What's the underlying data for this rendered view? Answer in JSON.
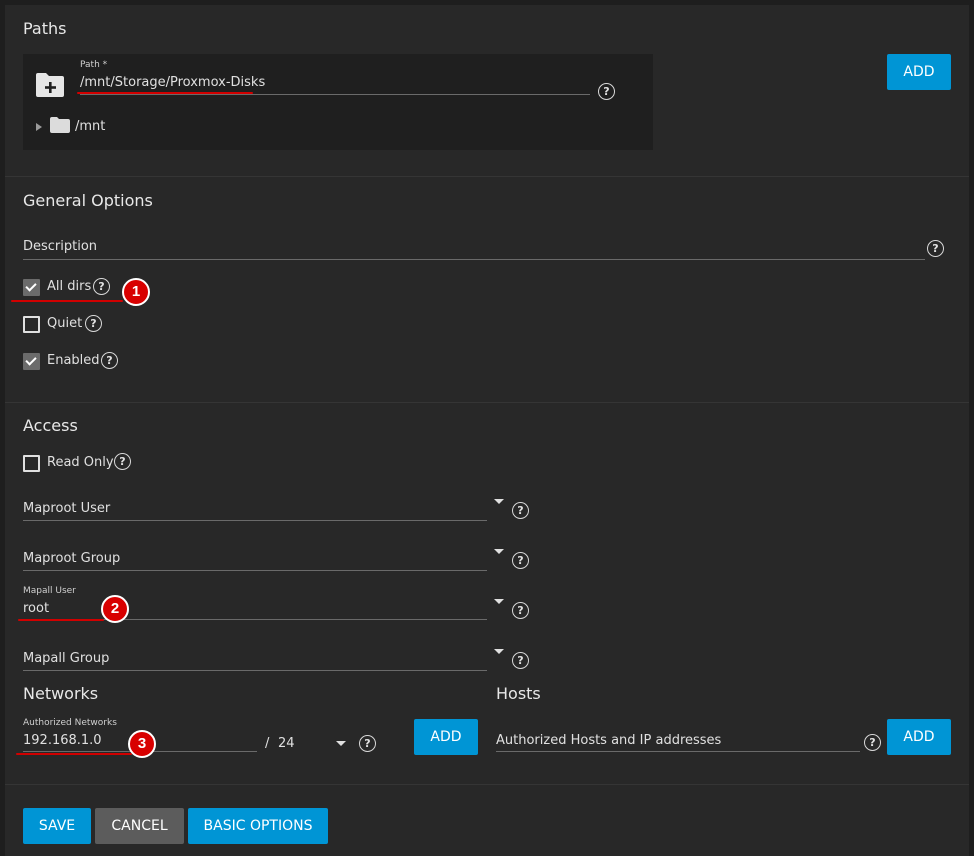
{
  "paths": {
    "title": "Paths",
    "path_label": "Path *",
    "path_value": "/mnt/Storage/Proxmox-Disks",
    "tree_item": "/mnt",
    "add_label": "ADD"
  },
  "general": {
    "title": "General Options",
    "description_placeholder": "Description",
    "all_dirs_label": "All dirs",
    "all_dirs_checked": true,
    "quiet_label": "Quiet",
    "quiet_checked": false,
    "enabled_label": "Enabled",
    "enabled_checked": true
  },
  "access": {
    "title": "Access",
    "read_only_label": "Read Only",
    "read_only_checked": false,
    "maproot_user_placeholder": "Maproot User",
    "maproot_group_placeholder": "Maproot Group",
    "mapall_user_label": "Mapall User",
    "mapall_user_value": "root",
    "mapall_group_placeholder": "Mapall Group"
  },
  "networks": {
    "title": "Networks",
    "authorized_label": "Authorized Networks",
    "network_value": "192.168.1.0",
    "slash": "/",
    "mask_value": "24",
    "add_label": "ADD"
  },
  "hosts": {
    "title": "Hosts",
    "placeholder": "Authorized Hosts and IP addresses",
    "add_label": "ADD"
  },
  "footer": {
    "save_label": "SAVE",
    "cancel_label": "CANCEL",
    "basic_options_label": "BASIC OPTIONS"
  },
  "annotations": {
    "badge_1": "1",
    "badge_2": "2",
    "badge_3": "3",
    "color": "#d80000"
  },
  "help_glyph": "?",
  "colors": {
    "accent": "#0095d5",
    "background": "#282828",
    "text": "#e0e0e0"
  }
}
